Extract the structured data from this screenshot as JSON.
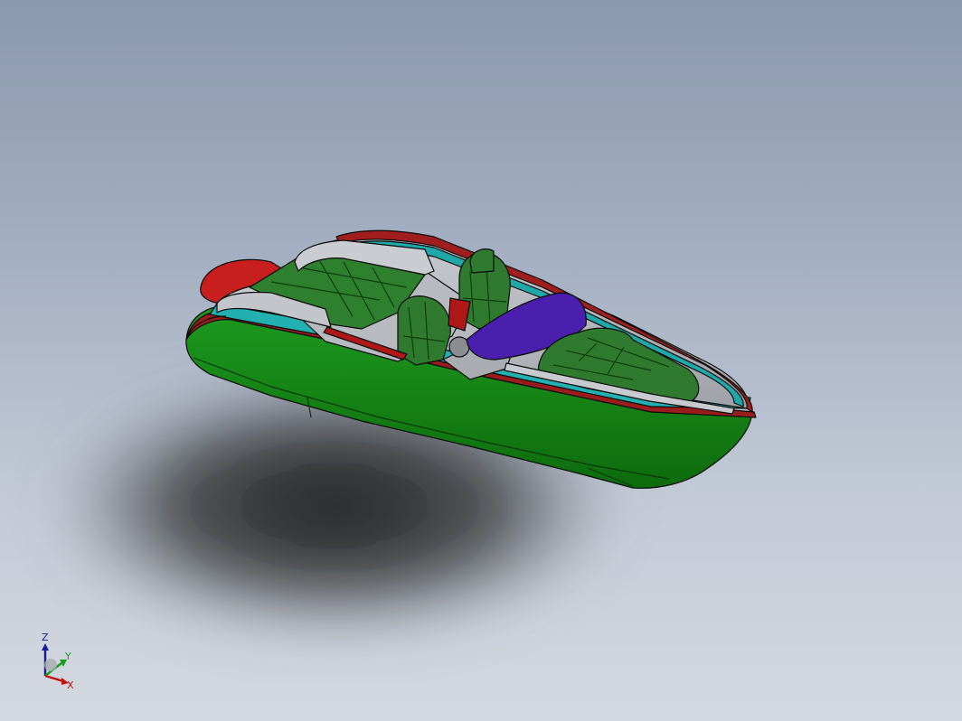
{
  "viewport": {
    "background_top": "#8a98ae",
    "background_bottom": "#d4d8e0"
  },
  "model": {
    "colors": {
      "hull": "#1f8f1f",
      "hull_dark": "#0e5e0e",
      "deck": "#b9bcc0",
      "trim_red": "#8b1a1a",
      "trim_cyan": "#1fa8a8",
      "seats": "#2f7a2f",
      "windshield": "#4a1fa8",
      "outline": "#0a0a0a",
      "shadow": "#1a1a1a"
    }
  },
  "triad": {
    "labels": {
      "z": "Z",
      "y": "Y",
      "x": "X"
    },
    "colors": {
      "z": "#1a1aa0",
      "y": "#13a013",
      "x": "#c01010"
    },
    "icon": "coordinate-triad-icon"
  }
}
